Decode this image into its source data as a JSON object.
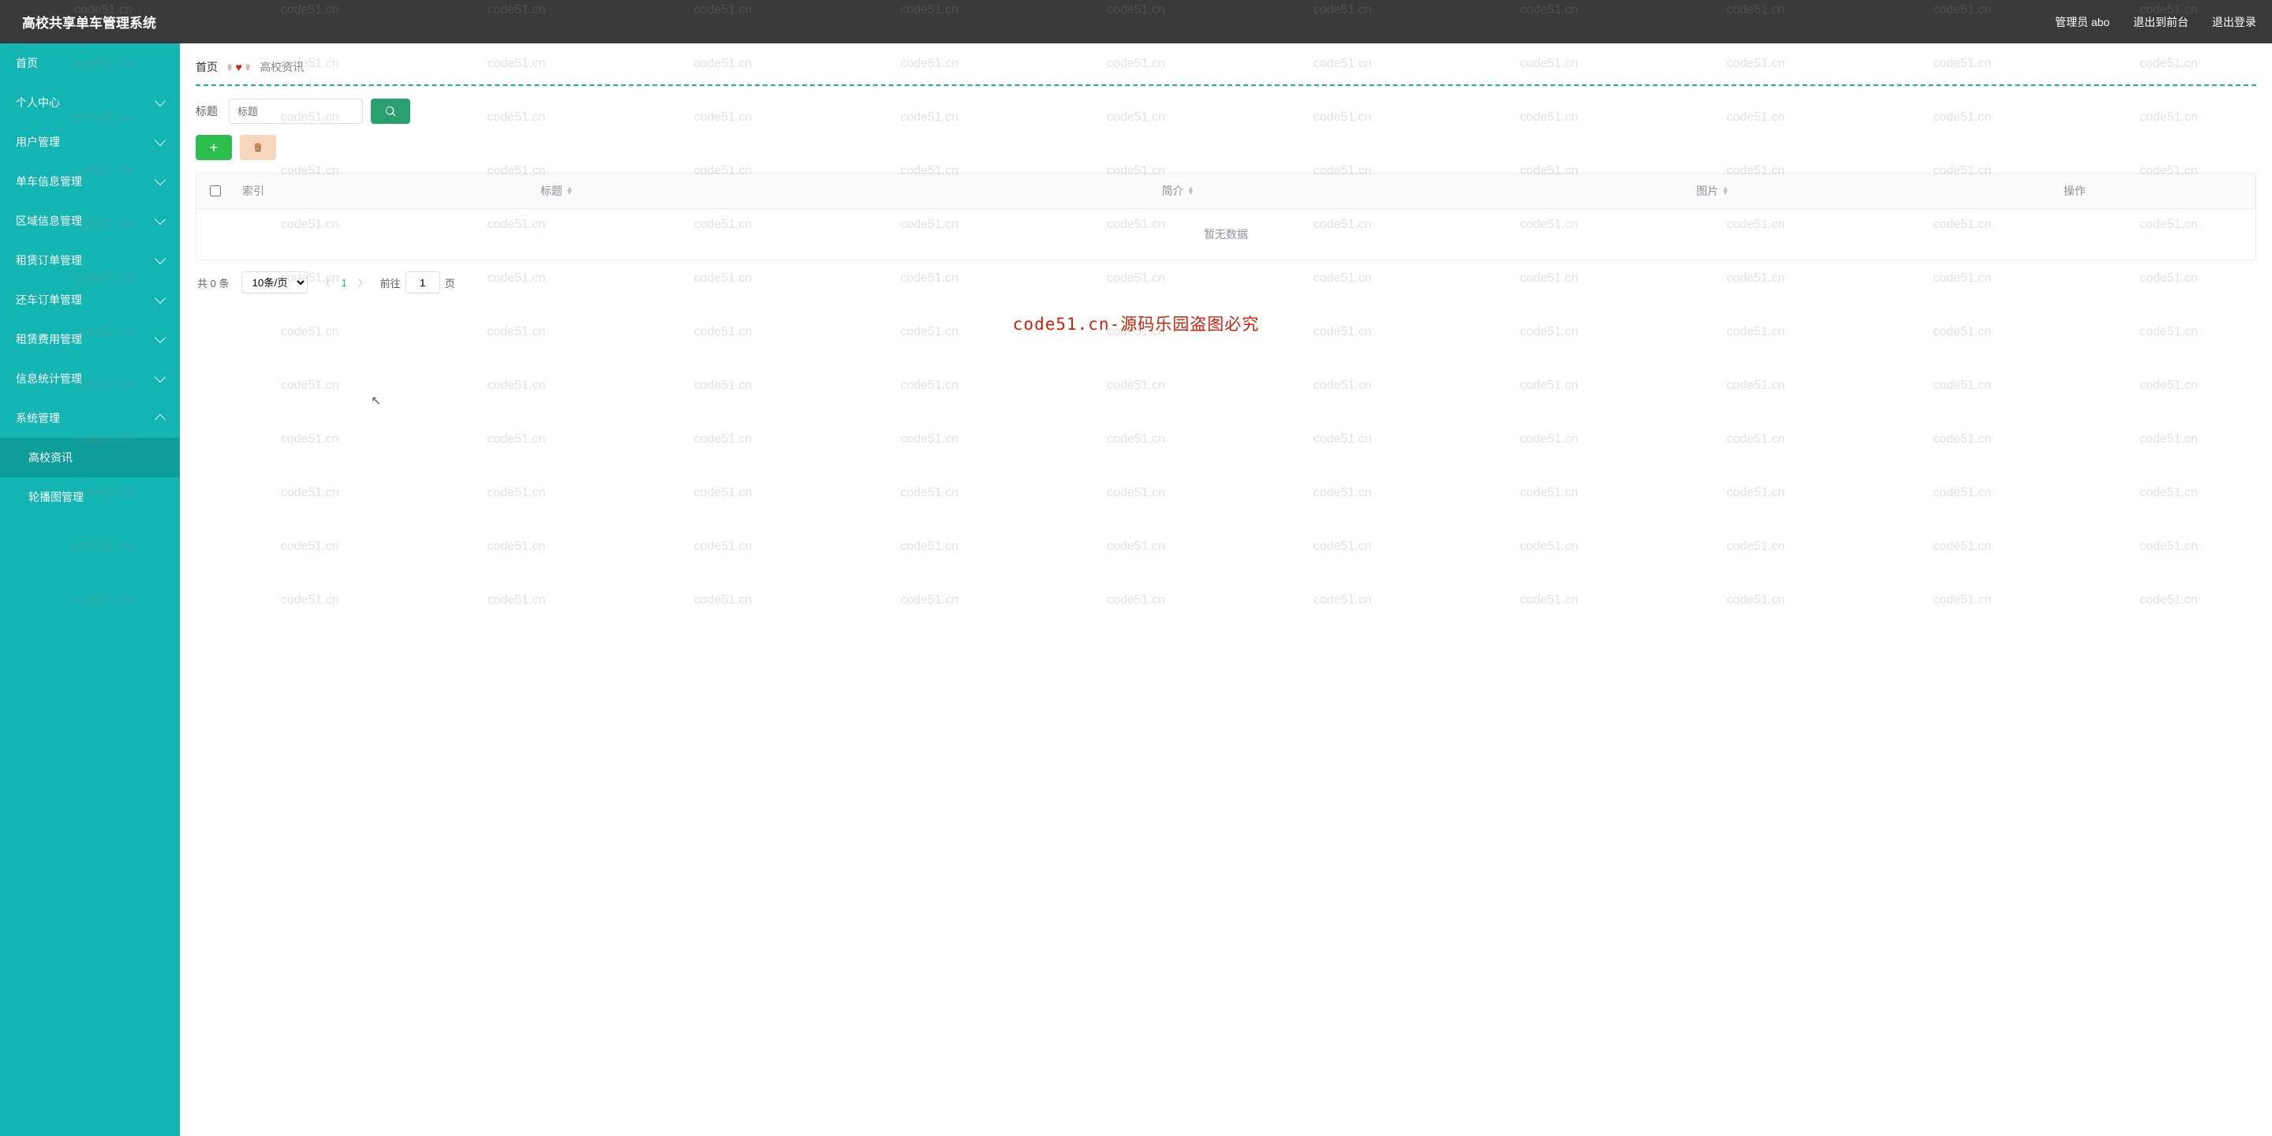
{
  "header": {
    "title": "高校共享单车管理系统",
    "admin_label": "管理员 abo",
    "exit_front_label": "退出到前台",
    "logout_label": "退出登录"
  },
  "sidebar": {
    "items": [
      {
        "label": "首页",
        "has_children": false
      },
      {
        "label": "个人中心",
        "has_children": true
      },
      {
        "label": "用户管理",
        "has_children": true
      },
      {
        "label": "单车信息管理",
        "has_children": true
      },
      {
        "label": "区域信息管理",
        "has_children": true
      },
      {
        "label": "租赁订单管理",
        "has_children": true
      },
      {
        "label": "还车订单管理",
        "has_children": true
      },
      {
        "label": "租赁费用管理",
        "has_children": true
      },
      {
        "label": "信息统计管理",
        "has_children": true
      },
      {
        "label": "系统管理",
        "has_children": true,
        "expanded": true,
        "children": [
          {
            "label": "高校资讯",
            "active": true
          },
          {
            "label": "轮播图管理"
          }
        ]
      }
    ]
  },
  "breadcrumb": {
    "home": "首页",
    "current": "高校资讯"
  },
  "filter": {
    "label": "标题",
    "placeholder": "标题"
  },
  "table": {
    "columns": {
      "index": "索引",
      "title": "标题",
      "summary": "简介",
      "image": "图片",
      "action": "操作"
    },
    "empty_text": "暂无数据"
  },
  "pagination": {
    "total_text": "共 0 条",
    "page_size_label": "10条/页",
    "current_page": "1",
    "goto_prefix": "前往",
    "goto_value": "1",
    "goto_suffix": "页"
  },
  "watermark": {
    "small": "code51.cn",
    "big": "code51.cn-源码乐园盗图必究"
  }
}
